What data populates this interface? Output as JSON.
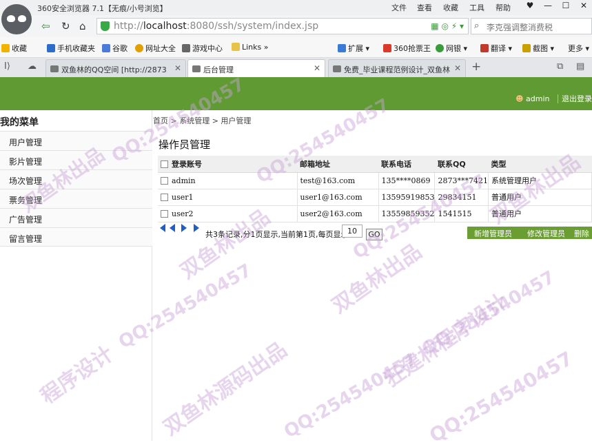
{
  "browser": {
    "title": "360安全浏览器 7.1【无痕/小号浏览】",
    "menu": [
      "文件",
      "查看",
      "收藏",
      "工具",
      "帮助"
    ],
    "url_prefix": "http://",
    "url_host": "localhost",
    "url_rest": ":8080/ssh/system/index.jsp",
    "search_placeholder": "李克强调整消费税",
    "bookmarks": [
      "收藏",
      "手机收藏夹",
      "谷歌",
      "网址大全",
      "游戏中心",
      "Links",
      "扩展",
      "360抢票王",
      "网银",
      "翻译",
      "截图",
      "更多"
    ],
    "tabs": [
      "双鱼林的QQ空间 [http://2873",
      "后台管理",
      "免费_毕业课程范例设计_双鱼林"
    ]
  },
  "header": {
    "user": "admin",
    "logout": "退出登录"
  },
  "sidebar": {
    "title": "我的菜单",
    "items": [
      "用户管理",
      "影片管理",
      "场次管理",
      "票务管理",
      "广告管理",
      "留言管理"
    ]
  },
  "breadcrumb": "首页 > 系统管理 > 用户管理",
  "content_title": "操作员管理",
  "table": {
    "headers": [
      "登录账号",
      "邮箱地址",
      "联系电话",
      "联系QQ",
      "类型"
    ],
    "rows": [
      [
        "admin",
        "test@163.com",
        "135****0869",
        "2873***7421",
        "系统管理用户"
      ],
      [
        "user1",
        "user1@163.com",
        "13595919853",
        "29834151",
        "普通用户"
      ],
      [
        "user2",
        "user2@163.com",
        "13559859352",
        "1541515",
        "普通用户"
      ]
    ]
  },
  "pager": {
    "summary": "共3条记录,分1页显示,当前第1页,每页显示",
    "page_size": "10",
    "go": "GO"
  },
  "actions": [
    "新增管理员",
    "修改管理员",
    "删除"
  ],
  "watermarks": [
    "QQ:254540457",
    "双鱼林出品",
    "程序设计",
    "双鱼林源码出品",
    "狂建林程序设计"
  ]
}
